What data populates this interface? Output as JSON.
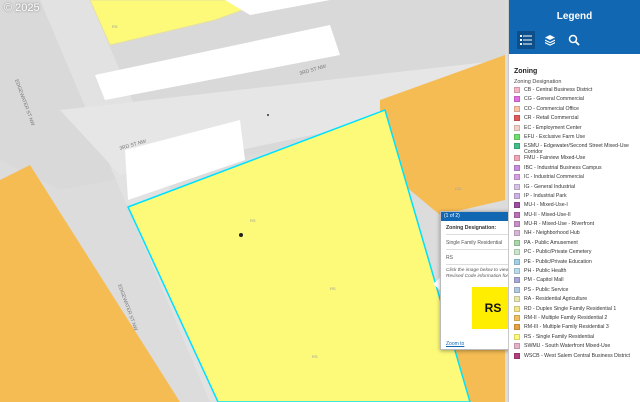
{
  "watermark": "© 2025",
  "map": {
    "colors": {
      "residential": "#fdfa7a",
      "commercial": "#f6bc54",
      "road": "#d4d4d4",
      "parcel_select": "#00e0ff"
    },
    "street_labels": [
      "3RD ST NW",
      "3RD ST NW",
      "EDGEWATER ST NW",
      "EDGEWATER ST NW"
    ],
    "parcel_labels": [
      "RS",
      "RS",
      "CO",
      "RS",
      "RS"
    ]
  },
  "legend": {
    "title": "Legend",
    "tools": [
      {
        "icon": "legend-list-icon"
      },
      {
        "icon": "layers-icon"
      },
      {
        "icon": "search-icon"
      }
    ],
    "layer_title": "Zoning",
    "field_title": "Zoning Designation",
    "items": [
      {
        "label": "CB - Central Business District",
        "color": "#f4b6c2"
      },
      {
        "label": "CG - General Commercial",
        "color": "#e36fe0"
      },
      {
        "label": "CO - Commercial Office",
        "color": "#f8c5a6"
      },
      {
        "label": "CR - Retail Commercial",
        "color": "#e25b5b"
      },
      {
        "label": "EC - Employment Center",
        "color": "#f3d3c8"
      },
      {
        "label": "EFU - Exclusive Farm Use",
        "color": "#6fe06f"
      },
      {
        "label": "ESMU - Edgewater/Second Street Mixed-Use Corridor",
        "color": "#3fbf8a"
      },
      {
        "label": "FMU - Fairview Mixed-Use",
        "color": "#f2a7b8"
      },
      {
        "label": "IBC - Industrial Business Campus",
        "color": "#c78ee0"
      },
      {
        "label": "IC - Industrial Commercial",
        "color": "#d7a0e6"
      },
      {
        "label": "IG - General Industrial",
        "color": "#d9c2e8"
      },
      {
        "label": "IP - Industrial Park",
        "color": "#cdb2e6"
      },
      {
        "label": "MU-I - Mixed-Use-I",
        "color": "#9d4f9d"
      },
      {
        "label": "MU-II - Mixed-Use-II",
        "color": "#b870b8"
      },
      {
        "label": "MU-R - Mixed-Use - Riverfront",
        "color": "#c890c8"
      },
      {
        "label": "NH - Neighborhood Hub",
        "color": "#d7b7d7"
      },
      {
        "label": "PA - Public Amusement",
        "color": "#a9d7a9"
      },
      {
        "label": "PC - Public/Private Cemetery",
        "color": "#c8e6c8"
      },
      {
        "label": "PE - Public/Private Education",
        "color": "#9fd0e6"
      },
      {
        "label": "PH - Public Health",
        "color": "#b8dcea"
      },
      {
        "label": "PM - Capitol Mall",
        "color": "#a8a8d8"
      },
      {
        "label": "PS - Public Service",
        "color": "#b0c8e0"
      },
      {
        "label": "RA - Residential Agriculture",
        "color": "#e6e6b0"
      },
      {
        "label": "RD - Duplex Single Family Residential 1",
        "color": "#f3e68a"
      },
      {
        "label": "RM-II - Multiple Family Residential 2",
        "color": "#f0c060"
      },
      {
        "label": "RM-III - Multiple Family Residential 3",
        "color": "#e8a040"
      },
      {
        "label": "RS - Single Family Residential",
        "color": "#fdfa7a"
      },
      {
        "label": "SWMU - South Waterfront Mixed-Use",
        "color": "#e6b0c8"
      },
      {
        "label": "WSCB - West Salem Central Business District",
        "color": "#b04080"
      }
    ]
  },
  "popup": {
    "counter": "(1 of 2)",
    "field_label": "Zoning Designation:",
    "zoning_name": "Single Family Residential",
    "zoning_code": "RS",
    "instruction": "Click the image below to view the Salem Revised Code information for this zone.",
    "badge_text": "RS",
    "zoom_link": "Zoom to",
    "more": "•••"
  }
}
